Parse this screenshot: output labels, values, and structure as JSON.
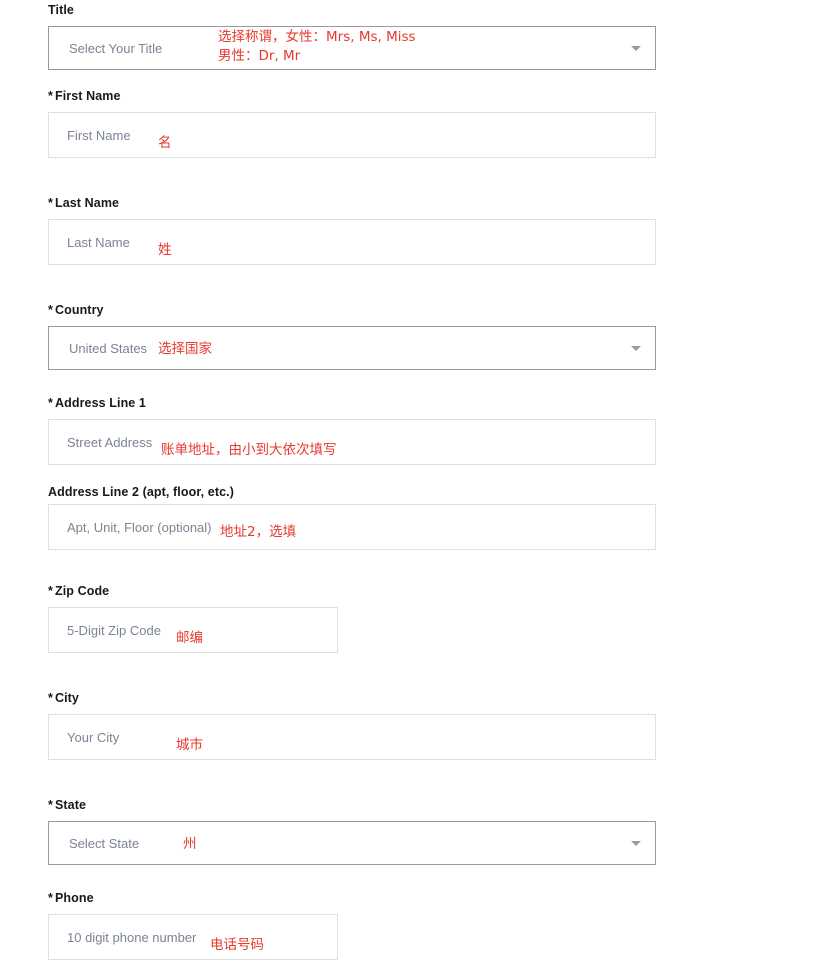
{
  "form": {
    "fields": [
      {
        "id": "title",
        "label": "Title",
        "required": false,
        "control": "select",
        "placeholder": "Select Your Title",
        "annotation": "选择称谓，女性：Mrs, Ms, Miss\n男性：Dr, Mr"
      },
      {
        "id": "first-name",
        "label": "First Name",
        "required": true,
        "star": "*",
        "control": "text",
        "placeholder": "First Name",
        "annotation": "名"
      },
      {
        "id": "last-name",
        "label": "Last Name",
        "required": true,
        "star": "*",
        "control": "text",
        "placeholder": "Last Name",
        "annotation": "姓"
      },
      {
        "id": "country",
        "label": "Country",
        "required": true,
        "star": "*",
        "control": "select",
        "placeholder": "United States",
        "annotation": "选择国家"
      },
      {
        "id": "address1",
        "label": "Address Line 1",
        "required": true,
        "star": "*",
        "control": "text",
        "placeholder": "Street Address",
        "annotation": "账单地址，由小到大依次填写"
      },
      {
        "id": "address2",
        "label": "Address Line 2 (apt, floor, etc.)",
        "required": false,
        "control": "text",
        "placeholder": "Apt, Unit, Floor (optional)",
        "annotation": "地址2，选填"
      },
      {
        "id": "zip",
        "label": "Zip Code",
        "required": true,
        "star": "*",
        "control": "text",
        "placeholder": "5-Digit Zip Code",
        "annotation": "邮编"
      },
      {
        "id": "city",
        "label": "City",
        "required": true,
        "star": "*",
        "control": "text",
        "placeholder": "Your City",
        "annotation": "城市"
      },
      {
        "id": "state",
        "label": "State",
        "required": true,
        "star": "*",
        "control": "select",
        "placeholder": "Select State",
        "annotation": "州"
      },
      {
        "id": "phone",
        "label": "Phone",
        "required": true,
        "star": "*",
        "control": "text",
        "placeholder": "10 digit phone number",
        "annotation": "电话号码"
      }
    ]
  },
  "colors": {
    "annotation_red": "#e8382e",
    "label_text": "#191919",
    "placeholder_text": "#7b8493",
    "input_border": "#e0e0e0",
    "select_border": "#9a9a9a",
    "background": "#ffffff"
  }
}
